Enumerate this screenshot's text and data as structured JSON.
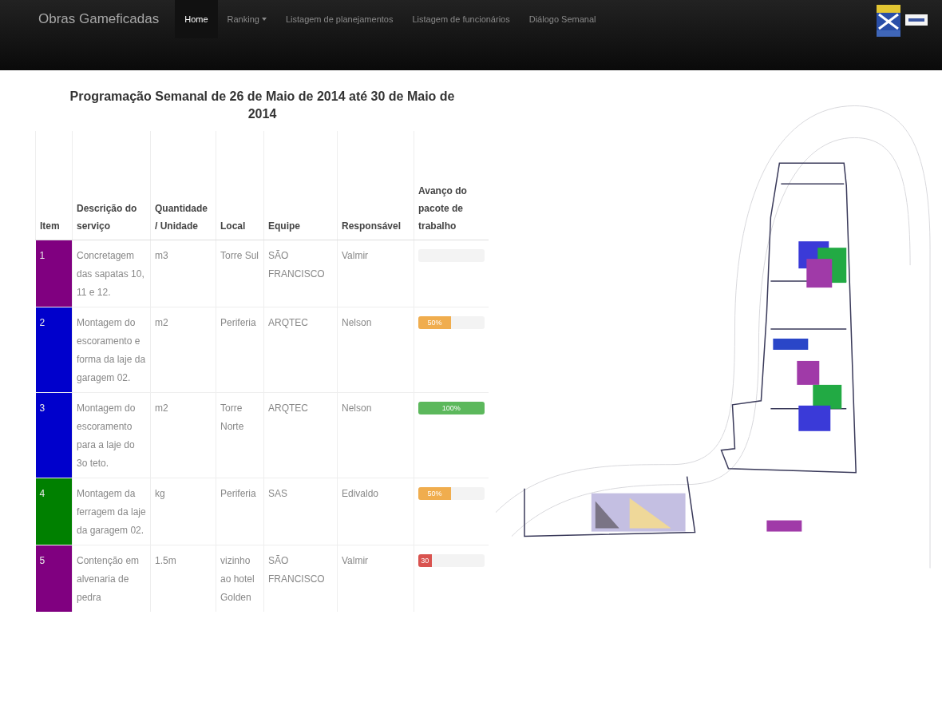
{
  "navbar": {
    "brand": "Obras Gameficadas",
    "items": [
      {
        "label": "Home",
        "selected": true,
        "kind": "link"
      },
      {
        "label": "Ranking",
        "selected": false,
        "kind": "dropdown"
      },
      {
        "label": "Listagem de planejamentos",
        "selected": false,
        "kind": "link"
      },
      {
        "label": "Listagem de funcionários",
        "selected": false,
        "kind": "link"
      },
      {
        "label": "Diálogo Semanal",
        "selected": false,
        "kind": "link"
      }
    ]
  },
  "schedule": {
    "title": "Programação Semanal de 26 de Maio de 2014 até 30 de Maio de 2014",
    "columns": [
      "Item",
      "Descrição do serviço",
      "Quantidade / Unidade",
      "Local",
      "Equipe",
      "Responsável",
      "Avanço do pacote de trabalho"
    ],
    "rows": [
      {
        "item": "1",
        "color": "#800080",
        "description": "Concretagem das sapatas 10, 11 e 12.",
        "quantity": "m3",
        "local": "Torre Sul",
        "team": "SÃO FRANCISCO",
        "responsible": "Valmir"
      },
      {
        "item": "2",
        "color": "#0000cc",
        "description": "Montagem do escoramento e forma da laje da garagem 02.",
        "quantity": "m2",
        "local": "Periferia",
        "team": "ARQTEC",
        "responsible": "Nelson",
        "progress": {
          "level": 0.5,
          "label": "50%",
          "kind": "warning"
        }
      },
      {
        "item": "3",
        "color": "#0000cc",
        "description": "Montagem do escoramento para a laje do 3o teto.",
        "quantity": "m2",
        "local": "Torre Norte",
        "team": "ARQTEC",
        "responsible": "Nelson",
        "progress": {
          "level": 1,
          "label": "100%",
          "kind": "success"
        }
      },
      {
        "item": "4",
        "color": "#008000",
        "description": "Montagem da ferragem da laje da garagem 02.",
        "quantity": "kg",
        "local": "Periferia",
        "team": "SAS",
        "responsible": "Edivaldo",
        "progress": {
          "level": 0.5,
          "label": "50%",
          "kind": "warning"
        }
      },
      {
        "item": "5",
        "color": "#800080",
        "description": "Contenção em alvenaria de pedra",
        "quantity": "1.5m",
        "local": "vizinho ao hotel Golden",
        "team": "SÃO FRANCISCO",
        "responsible": "Valmir",
        "progress": {
          "level": 0.2,
          "label": "30",
          "kind": "danger"
        }
      }
    ]
  }
}
